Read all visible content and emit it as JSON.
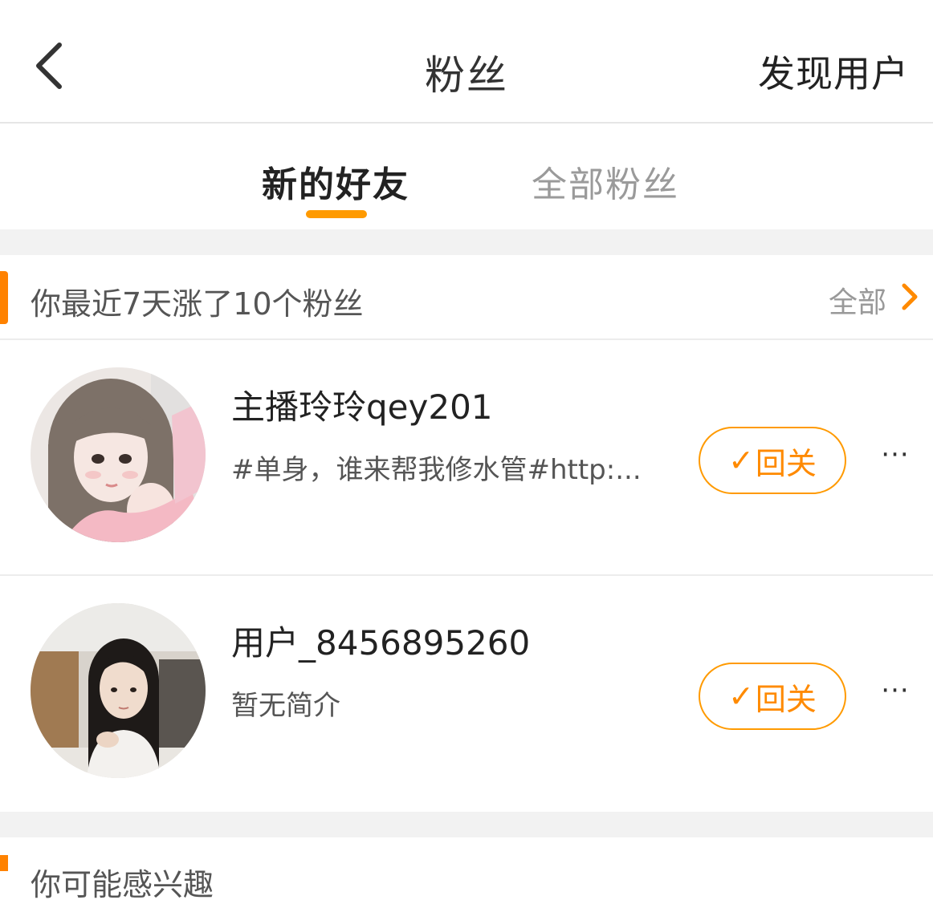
{
  "header": {
    "title": "粉丝",
    "discover_label": "发现用户"
  },
  "tabs": [
    {
      "label": "新的好友",
      "active": true
    },
    {
      "label": "全部粉丝",
      "active": false
    }
  ],
  "section": {
    "text": "你最近7天涨了10个粉丝",
    "all_label": "全部"
  },
  "fans": [
    {
      "name": "主播玲玲qey201",
      "bio": "#单身，谁来帮我修水管#http:...",
      "button_label": "回关",
      "more": "···"
    },
    {
      "name": "用户_8456895260",
      "bio": "暂无简介",
      "button_label": "回关",
      "more": "···"
    }
  ],
  "bottom_section": {
    "text": "你可能感兴趣"
  },
  "colors": {
    "accent": "#ff8a00",
    "tab_underline": "#ff9a00",
    "divider": "#ececec",
    "gap": "#f2f2f2"
  },
  "icons": {
    "back": "chevron-left-icon",
    "section_more": "chevron-right-icon",
    "follow_check": "check-icon",
    "more": "more-dots-icon"
  }
}
